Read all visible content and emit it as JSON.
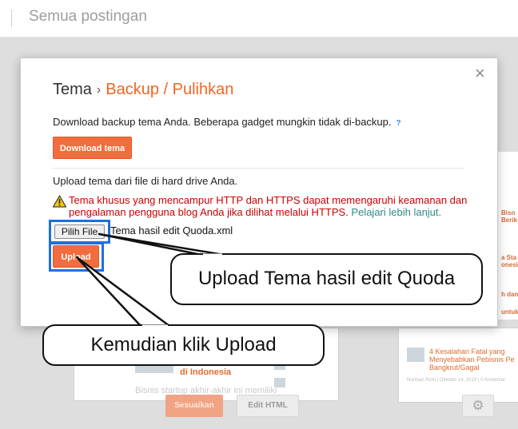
{
  "header": {
    "title": "Semua postingan"
  },
  "dialog": {
    "breadcrumb_root": "Tema",
    "breadcrumb_separator": "›",
    "breadcrumb_current": "Backup / Pulihkan",
    "close_label": "×",
    "backup_description": "Download backup tema Anda. Beberapa gadget mungkin tidak di-backup.",
    "help_label": "?",
    "download_button": "Download tema",
    "upload_description": "Upload tema dari file di hard drive Anda.",
    "warning_text": "Tema khusus yang mencampur HTTP dan HTTPS dapat memengaruhi keamanan dan pengalaman pengguna blog Anda jika dilihat melalui HTTPS.",
    "learn_more": "Pelajari lebih lanjut.",
    "file_button": "Pilih File",
    "file_name": "Tema hasil edit Quoda.xml",
    "upload_button": "Upload"
  },
  "annotations": {
    "callout_upload_theme": "Upload Tema hasil edit Quoda",
    "callout_click_upload": "Kemudian klik Upload"
  },
  "background": {
    "post_heading": "di Indonesia",
    "post_snippet": "Bisnis startup akhir-akhir ini memiliki",
    "sidebar_post_title": "4 Kesalahan Fatal yang Menyebabkan Pebisnis Pe Bangkrut/Gagal",
    "sidebar_meta": "Nurman Rizki | Oktober 14, 2018 | 0 Komentar",
    "right_edge_titles": [
      "Bisn Berik",
      "a Sta onesi",
      "h dan",
      "untuk"
    ],
    "customize_button": "Sesuaikan",
    "edit_html_button": "Edit HTML",
    "settings_icon": "gear-icon"
  },
  "colors": {
    "accent": "#f26522",
    "button": "#f26d3d",
    "warning": "#cc0000",
    "link": "#2e8b87",
    "highlight": "#1e6fe0"
  }
}
